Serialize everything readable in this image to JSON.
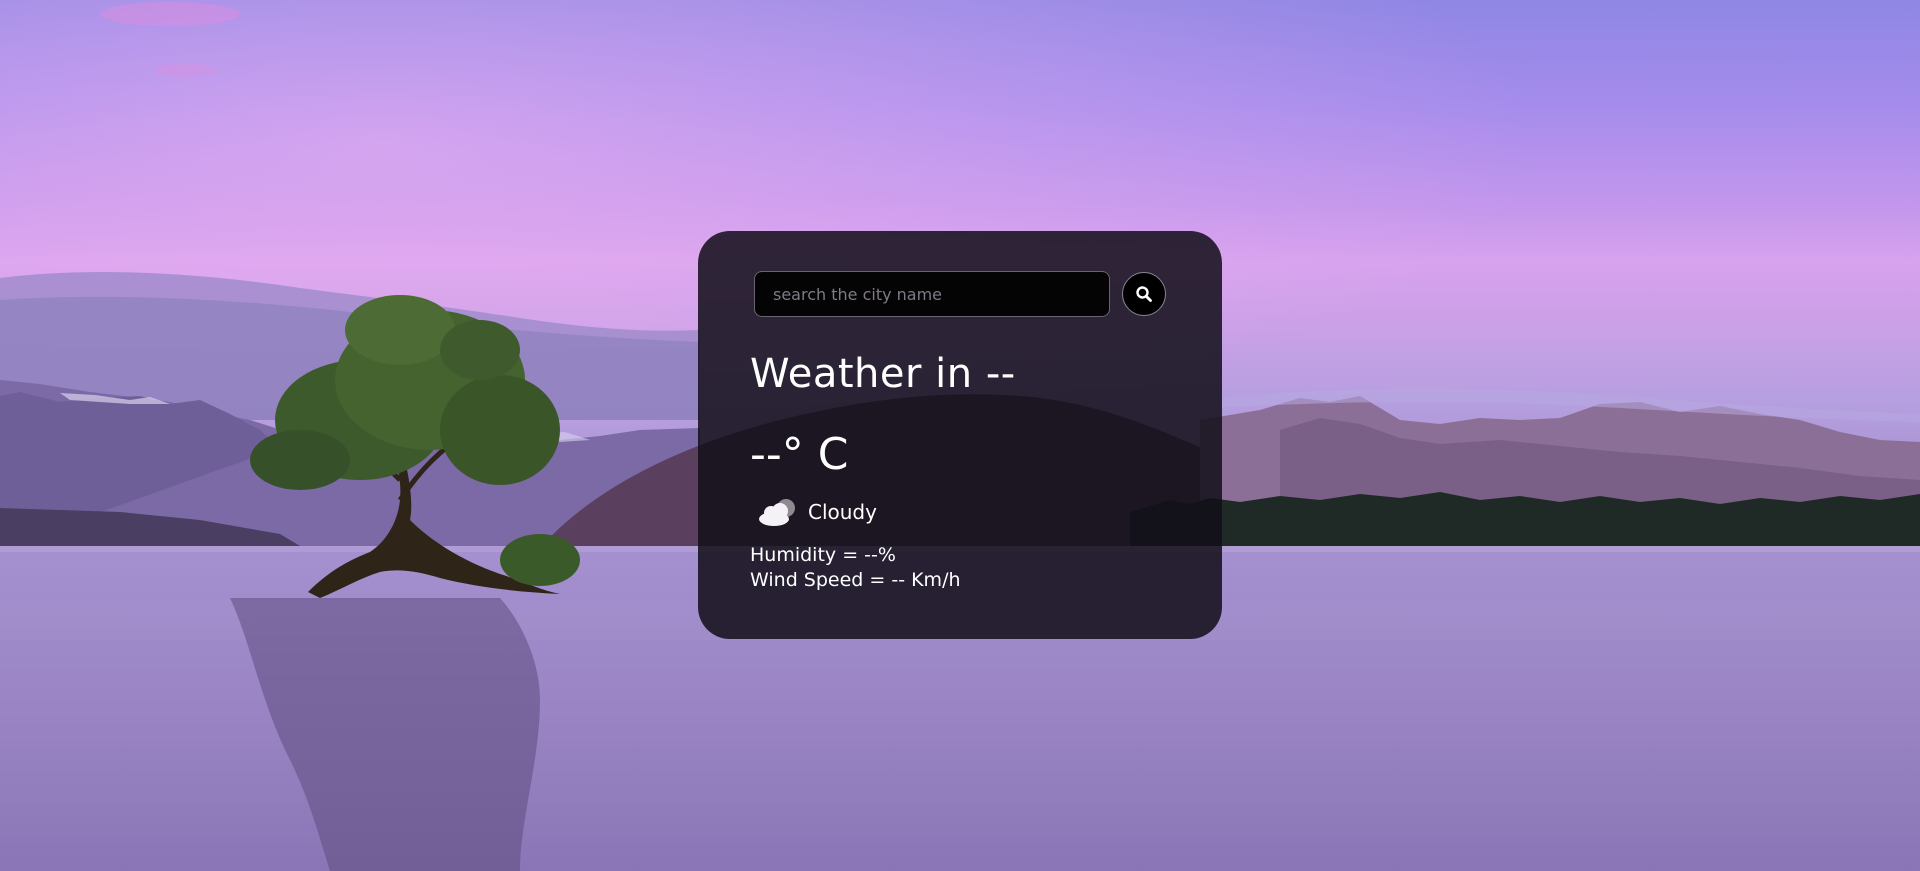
{
  "search": {
    "placeholder": "search the city name",
    "value": "",
    "button_icon": "search-icon"
  },
  "weather": {
    "title": "Weather in --",
    "temperature": "--° C",
    "condition_icon": "cloud-icon",
    "condition": "Cloudy",
    "humidity": "Humidity = --%",
    "wind_speed": "Wind Speed = -- Km/h"
  },
  "colors": {
    "card_background": "#120e18",
    "text": "#ffffff",
    "input_background": "#040404",
    "sky_top": "#8f86e4",
    "sky_glow": "#d7a2ee",
    "water": "#9a84c4"
  }
}
